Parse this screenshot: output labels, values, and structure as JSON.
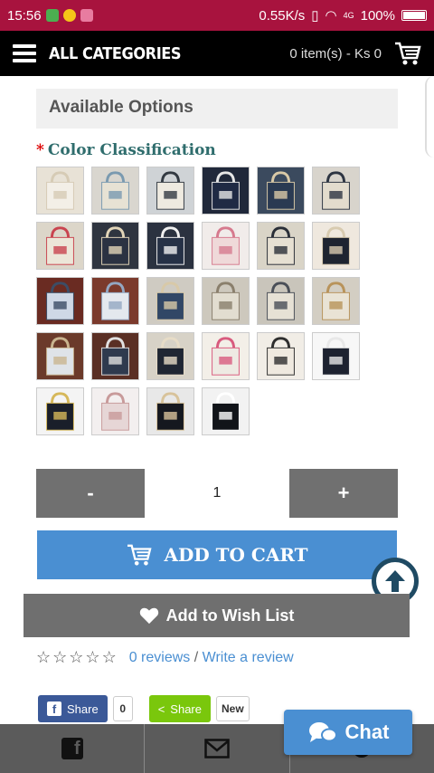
{
  "status_bar": {
    "time": "15:56",
    "network_speed": "0.55K/s",
    "signal": "4G",
    "battery": "100%"
  },
  "header": {
    "menu_icon": "hamburger-menu-icon",
    "title": "ALL CATEGORIES",
    "cart_summary": "0 item(s) - Ks 0",
    "cart_icon": "shopping-cart-icon"
  },
  "options": {
    "section_title": "Available Options",
    "required_marker": "*",
    "color_label": "Color Classification",
    "swatches": [
      {
        "bg": "#e8e2d6",
        "bag": "#f3efe7",
        "trim": "#d6cbb5"
      },
      {
        "bg": "#d9d6cf",
        "bag": "#e7e2d4",
        "trim": "#7a9ab0"
      },
      {
        "bg": "#cfd3d6",
        "bag": "#eeeae0",
        "trim": "#333a42"
      },
      {
        "bg": "#20283a",
        "bag": "#1f2a44",
        "trim": "#e6e6e6"
      },
      {
        "bg": "#3b4a5e",
        "bag": "#2a3a52",
        "trim": "#d9c9a7"
      },
      {
        "bg": "#d8d4cc",
        "bag": "#e3dccd",
        "trim": "#2d3542"
      },
      {
        "bg": "#dcd6c9",
        "bag": "#ece6d8",
        "trim": "#c9444f"
      },
      {
        "bg": "#2f3540",
        "bag": "#2b3242",
        "trim": "#e2d5b8"
      },
      {
        "bg": "#2b3240",
        "bag": "#263146",
        "trim": "#f0f0f0"
      },
      {
        "bg": "#f1ecea",
        "bag": "#efd9d9",
        "trim": "#d67a8e"
      },
      {
        "bg": "#d9d4c7",
        "bag": "#e6e0d2",
        "trim": "#2a2f38"
      },
      {
        "bg": "#efe8de",
        "bag": "#1e2430",
        "trim": "#d8cbb0"
      },
      {
        "bg": "#6a2b22",
        "bag": "#cfd8e6",
        "trim": "#3c4d66"
      },
      {
        "bg": "#7b3a2c",
        "bag": "#e4e8ee",
        "trim": "#93a7c2"
      },
      {
        "bg": "#cfcbc2",
        "bag": "#314766",
        "trim": "#d8c9a8"
      },
      {
        "bg": "#cdc8bd",
        "bag": "#e2ddd0",
        "trim": "#8a7f6c"
      },
      {
        "bg": "#c9c5bb",
        "bag": "#e6e1d5",
        "trim": "#4a4f58"
      },
      {
        "bg": "#d3cec3",
        "bag": "#e9e3d5",
        "trim": "#b8935a"
      },
      {
        "bg": "#6b3a2a",
        "bag": "#dfe3e8",
        "trim": "#c9b48f"
      },
      {
        "bg": "#5a2f24",
        "bag": "#2f3a4e",
        "trim": "#e0e0e0"
      },
      {
        "bg": "#d7d2c7",
        "bag": "#1f2633",
        "trim": "#e7dcc7"
      },
      {
        "bg": "#f3efe8",
        "bag": "#eeeae3",
        "trim": "#d85b7e"
      },
      {
        "bg": "#f1ede6",
        "bag": "#efe9df",
        "trim": "#2e2e2e"
      },
      {
        "bg": "#f7f7f7",
        "bag": "#1d2230",
        "trim": "#e8e8e8"
      },
      {
        "bg": "#f4f4f4",
        "bag": "#1a1f2a",
        "trim": "#d6b85a"
      },
      {
        "bg": "#f3efef",
        "bag": "#e6d6d6",
        "trim": "#c89a9a"
      },
      {
        "bg": "#e8e8e8",
        "bag": "#15181f",
        "trim": "#d8c39b"
      },
      {
        "bg": "#f2f2f2",
        "bag": "#111419",
        "trim": "#ffffff"
      }
    ]
  },
  "quantity": {
    "minus_label": "-",
    "value": "1",
    "plus_label": "+"
  },
  "actions": {
    "add_to_cart_label": "ADD TO CART",
    "wish_list_label": "Add to Wish List",
    "scroll_top_icon": "arrow-up-circle-icon"
  },
  "reviews": {
    "rating": 0,
    "max_rating": 5,
    "reviews_link": "0 reviews",
    "separator": "/",
    "write_link": "Write a review"
  },
  "share": {
    "facebook_label": "Share",
    "facebook_count": "0",
    "green_label": "Share",
    "green_count": "New"
  },
  "bottom_nav": {
    "items": [
      "facebook-icon",
      "mail-icon",
      "user-icon"
    ]
  },
  "chat": {
    "label": "Chat",
    "icon": "chat-bubbles-icon"
  },
  "colors": {
    "status_bar": "#a8133e",
    "top_bar": "#000000",
    "accent_blue": "#4a8fd2",
    "button_gray": "#707070",
    "label_teal": "#2f6d6d",
    "facebook_blue": "#3b5998",
    "share_green": "#7ac70c"
  }
}
